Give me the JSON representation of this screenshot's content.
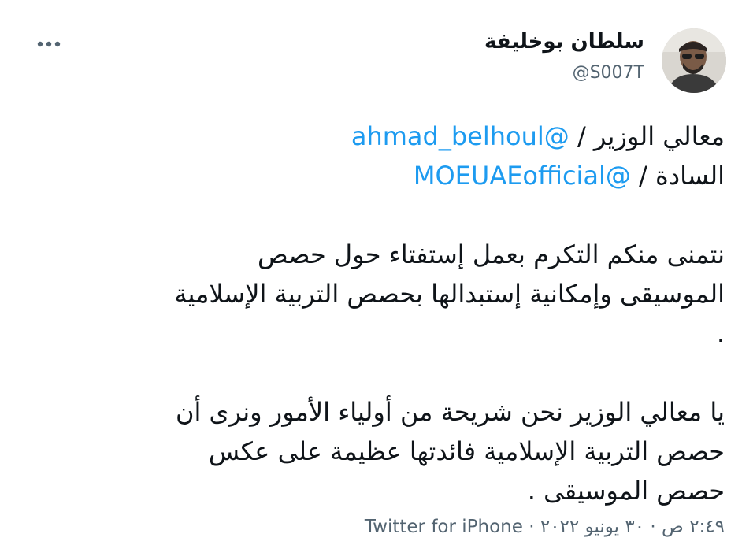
{
  "author": {
    "name": "سلطان بوخليفة",
    "handle": "@S007T"
  },
  "tweet": {
    "line1_prefix": "معالي الوزير",
    "line1_mention": "@ahmad_belhoul",
    "line2_prefix": "السادة",
    "line2_mention": "@MOEUAEofficial",
    "separator": "/",
    "para1_line1": "نتمنى منكم التكرم بعمل إستفتاء حول حصص",
    "para1_line2": "الموسيقى وإمكانية إستبدالها بحصص التربية الإسلامية",
    "para1_line3": ".",
    "para2_line1": "يا معالي الوزير نحن شريحة من أولياء الأمور ونرى أن",
    "para2_line2": "حصص التربية الإسلامية فائدتها عظيمة على عكس",
    "para2_line3": "حصص الموسيقى ."
  },
  "meta": {
    "datetime": "٢:٤٩ ص · ٣٠ يونيو ٢٠٢٢ ·",
    "source": "Twitter for iPhone"
  },
  "colors": {
    "link": "#1d9bf0",
    "secondary": "#536471",
    "text": "#0f1419"
  },
  "icons": {
    "more": "more-options-icon",
    "avatar": "profile-photo"
  }
}
